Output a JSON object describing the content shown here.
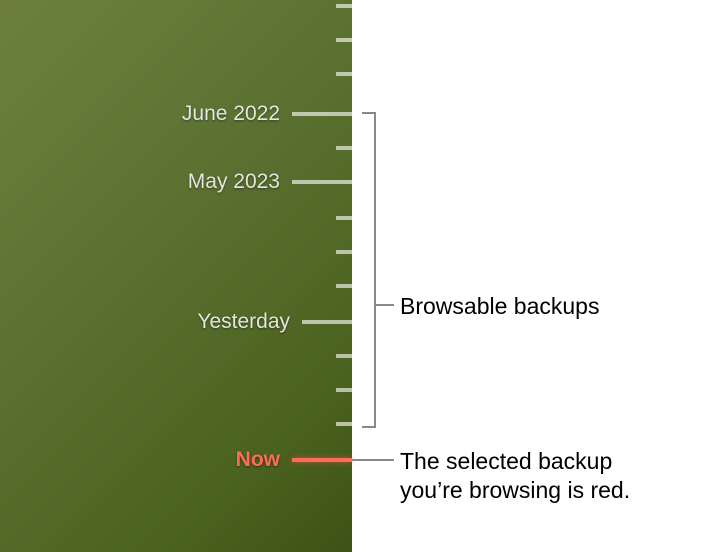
{
  "timeline": {
    "ticks": {
      "june2022": "June 2022",
      "may2023": "May 2023",
      "yesterday": "Yesterday",
      "now": "Now"
    }
  },
  "annotations": {
    "browsable": "Browsable backups",
    "selected_line1": "The selected backup",
    "selected_line2": "you’re browsing is red."
  },
  "colors": {
    "selected_tick": "#ff6a5b",
    "tick_normal": "rgba(255,255,255,0.62)",
    "panel_bg_from": "#6c7f3e",
    "panel_bg_to": "#3d5316"
  }
}
